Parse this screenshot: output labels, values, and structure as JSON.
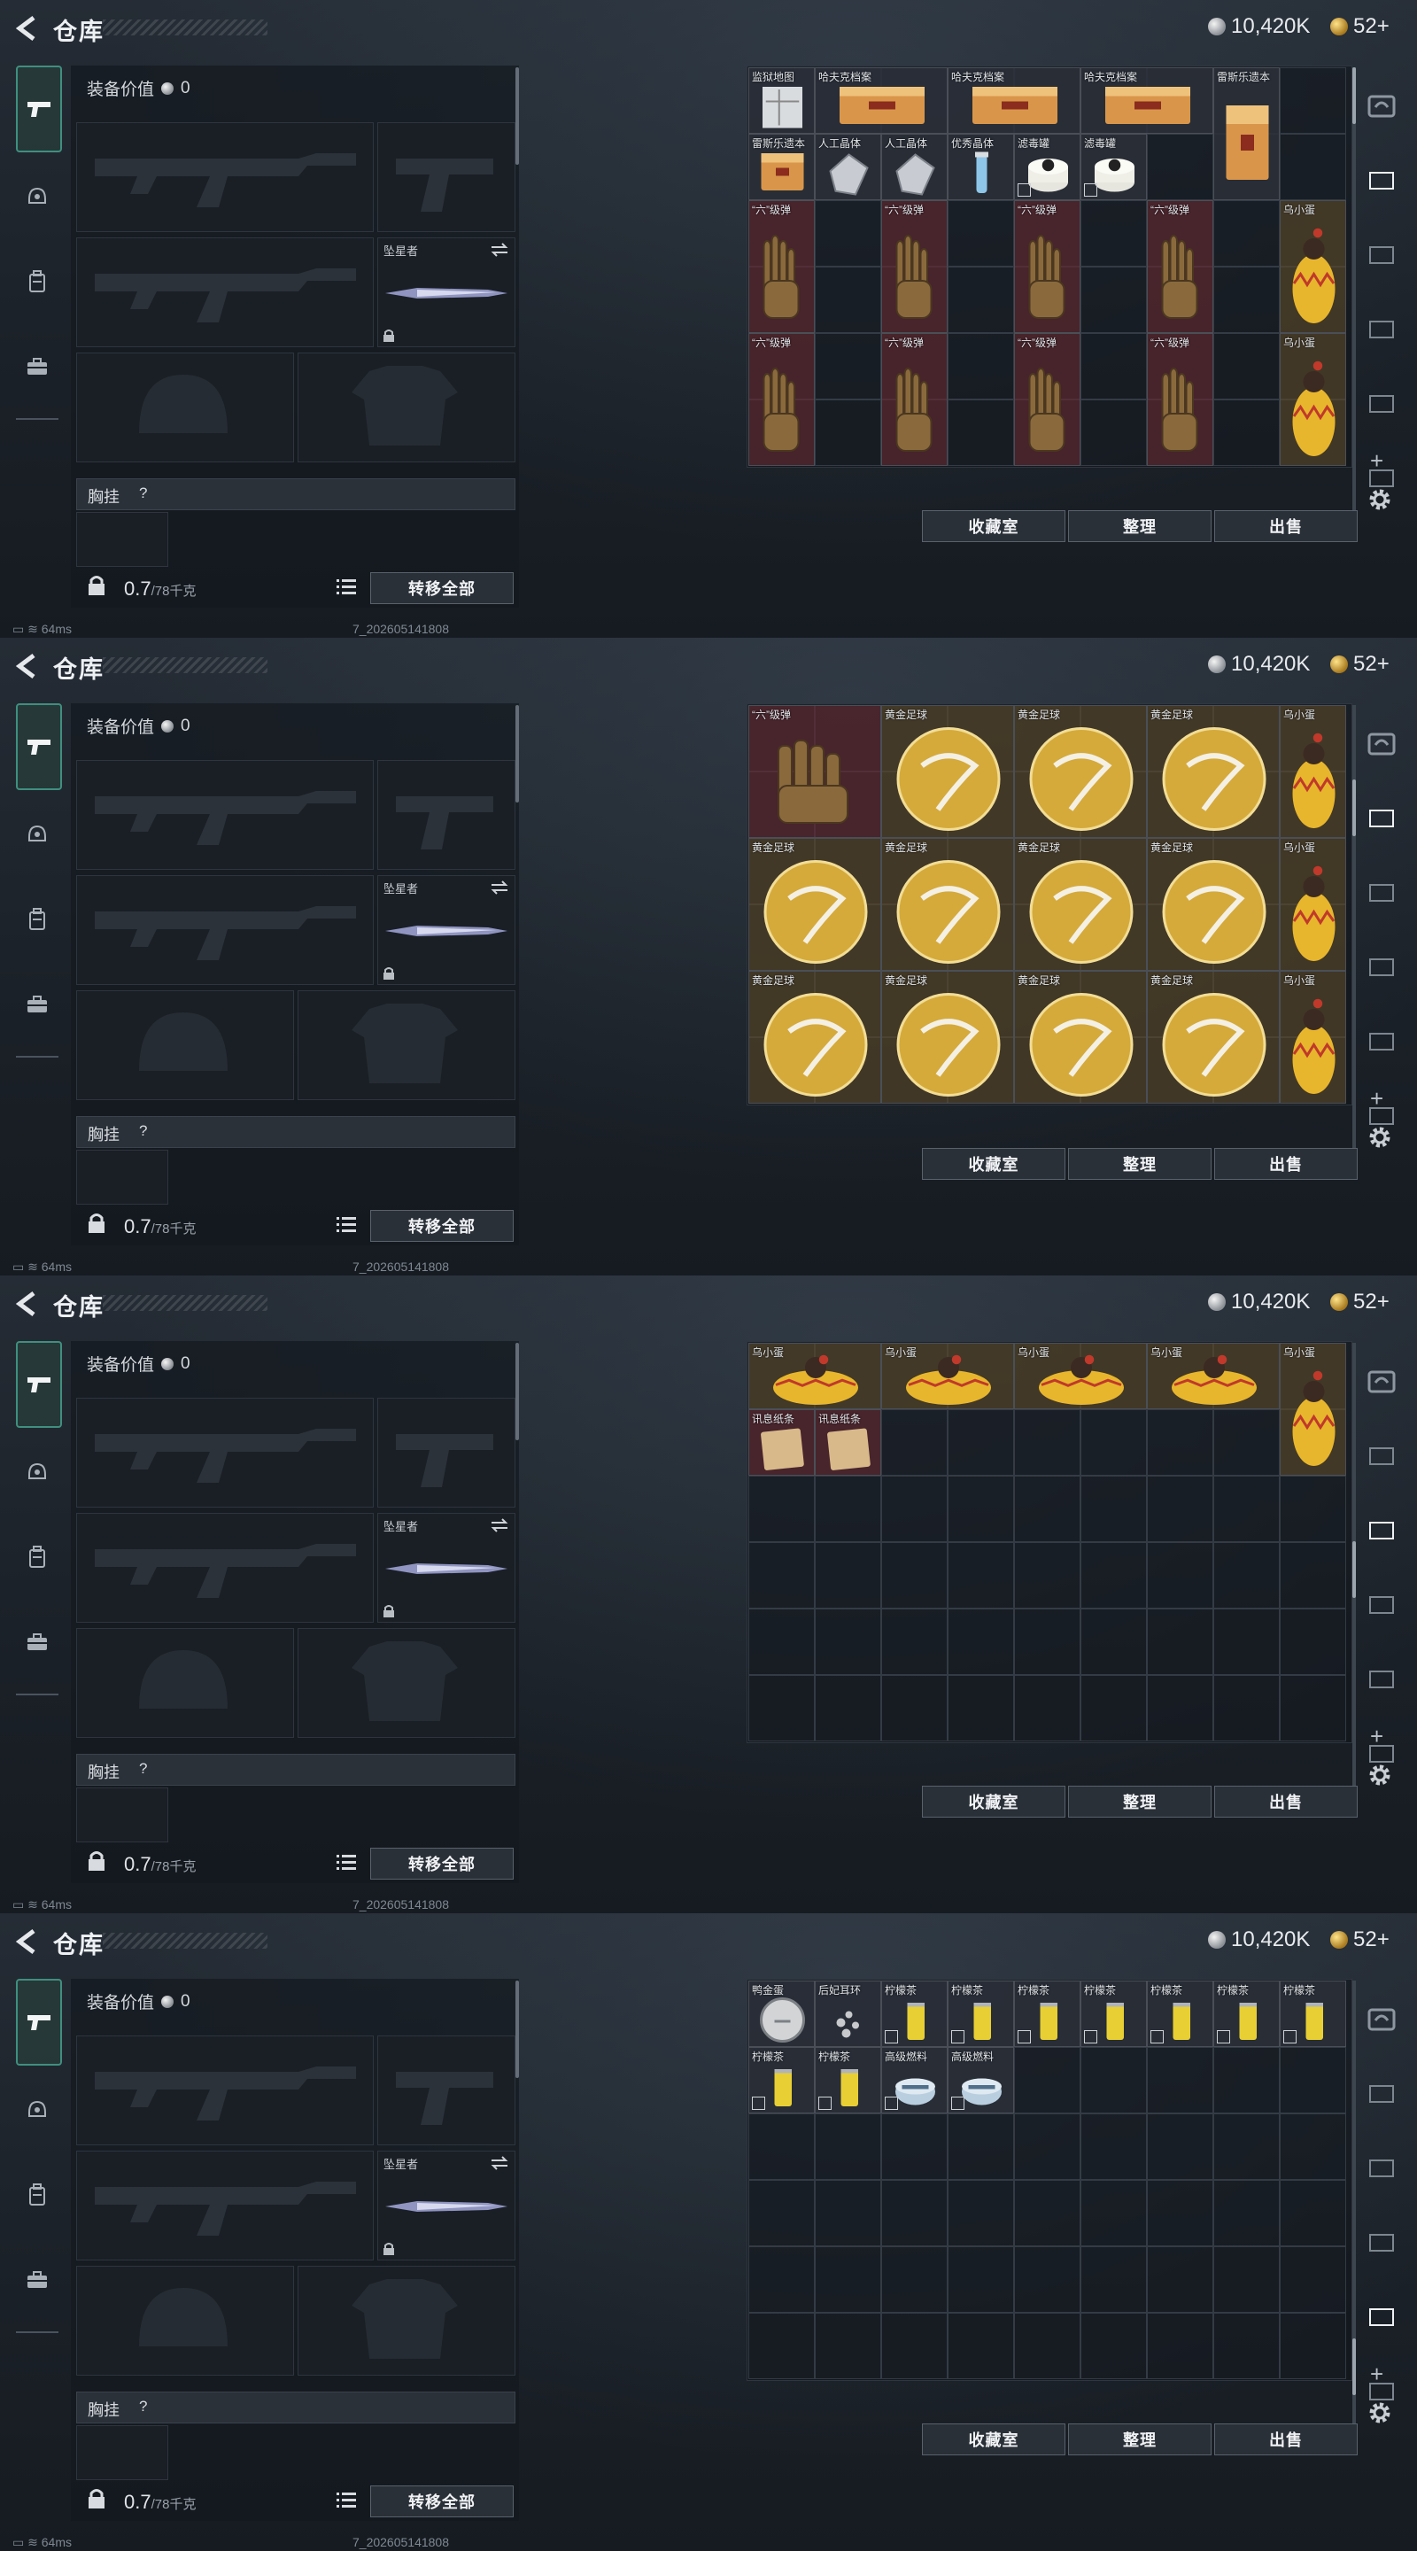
{
  "header": {
    "title": "仓库",
    "silver": "10,420K",
    "gold": "52+"
  },
  "equipment": {
    "value_label": "装备价值",
    "value": "0",
    "knife_label": "坠星者",
    "vest_label": "胸挂",
    "vest_q": "?",
    "weight": "0.7",
    "weight_max": "/78千克",
    "move_all": "转移全部"
  },
  "buttons": {
    "collection": "收藏室",
    "sort": "整理",
    "sell": "出售"
  },
  "footer": {
    "ping": "64ms",
    "code": "7_202605141808"
  },
  "colors": {
    "accent": "#3f8f7f",
    "red_item": "#66282f",
    "gold_item": "#5c4828"
  },
  "icons": [
    "back-arrow-icon",
    "silver-coin-icon",
    "gold-coin-icon",
    "pistol-icon",
    "helmet-icon",
    "backpack-icon",
    "briefcase-icon",
    "lock-icon",
    "swap-icon",
    "list-icon",
    "gear-icon",
    "plus-icon"
  ],
  "screens": [
    {
      "items": [
        {
          "name": "监狱地图",
          "art": "map"
        },
        {
          "name": "哈夫克档案",
          "art": "file"
        },
        {
          "name": "哈夫克档案",
          "art": "file"
        },
        {
          "name": "哈夫克档案",
          "art": "file"
        },
        {
          "name": "雷斯乐遗本",
          "art": "file"
        },
        {
          "name": "雷斯乐遗本",
          "art": "file"
        },
        {
          "name": "人工晶体",
          "art": "crystal"
        },
        {
          "name": "人工晶体",
          "art": "crystal"
        },
        {
          "name": "优秀晶体",
          "art": "vial"
        },
        {
          "name": "滤毒罐",
          "art": "canister"
        },
        {
          "name": "滤毒罐",
          "art": "canister"
        },
        {
          "name": "“六”级弹",
          "art": "hand"
        },
        {
          "name": "“六”级弹",
          "art": "hand"
        },
        {
          "name": "“六”级弹",
          "art": "hand"
        },
        {
          "name": "“六”级弹",
          "art": "hand"
        },
        {
          "name": "乌小蛋",
          "art": "egg"
        },
        {
          "name": "“六”级弹",
          "art": "hand"
        },
        {
          "name": "“六”级弹",
          "art": "hand"
        },
        {
          "name": "“六”级弹",
          "art": "hand"
        },
        {
          "name": "“六”级弹",
          "art": "hand"
        },
        {
          "name": "乌小蛋",
          "art": "egg"
        }
      ]
    },
    {
      "items": [
        {
          "name": "“六”级弹",
          "art": "hand"
        },
        {
          "name": "黄金足球",
          "art": "ball"
        },
        {
          "name": "黄金足球",
          "art": "ball"
        },
        {
          "name": "黄金足球",
          "art": "ball"
        },
        {
          "name": "乌小蛋",
          "art": "egg"
        },
        {
          "name": "黄金足球",
          "art": "ball"
        },
        {
          "name": "黄金足球",
          "art": "ball"
        },
        {
          "name": "黄金足球",
          "art": "ball"
        },
        {
          "name": "黄金足球",
          "art": "ball"
        },
        {
          "name": "乌小蛋",
          "art": "egg"
        },
        {
          "name": "黄金足球",
          "art": "ball"
        },
        {
          "name": "黄金足球",
          "art": "ball"
        },
        {
          "name": "黄金足球",
          "art": "ball"
        },
        {
          "name": "黄金足球",
          "art": "ball"
        },
        {
          "name": "乌小蛋",
          "art": "egg"
        }
      ]
    },
    {
      "items": [
        {
          "name": "乌小蛋",
          "art": "egg"
        },
        {
          "name": "乌小蛋",
          "art": "egg"
        },
        {
          "name": "乌小蛋",
          "art": "egg"
        },
        {
          "name": "乌小蛋",
          "art": "egg"
        },
        {
          "name": "乌小蛋",
          "art": "egg"
        },
        {
          "name": "讯息纸条",
          "art": "note"
        },
        {
          "name": "讯息纸条",
          "art": "note"
        }
      ]
    },
    {
      "items": [
        {
          "name": "鸭金蛋",
          "art": "coin"
        },
        {
          "name": "后妃耳环",
          "art": "earring"
        },
        {
          "name": "柠檬茶",
          "art": "can"
        },
        {
          "name": "柠檬茶",
          "art": "can"
        },
        {
          "name": "柠檬茶",
          "art": "can"
        },
        {
          "name": "柠檬茶",
          "art": "can"
        },
        {
          "name": "柠檬茶",
          "art": "can"
        },
        {
          "name": "柠檬茶",
          "art": "can"
        },
        {
          "name": "柠檬茶",
          "art": "can"
        },
        {
          "name": "柠檬茶",
          "art": "can"
        },
        {
          "name": "柠檬茶",
          "art": "can"
        },
        {
          "name": "高级燃料",
          "art": "fuel"
        },
        {
          "name": "高级燃料",
          "art": "fuel"
        }
      ]
    }
  ]
}
